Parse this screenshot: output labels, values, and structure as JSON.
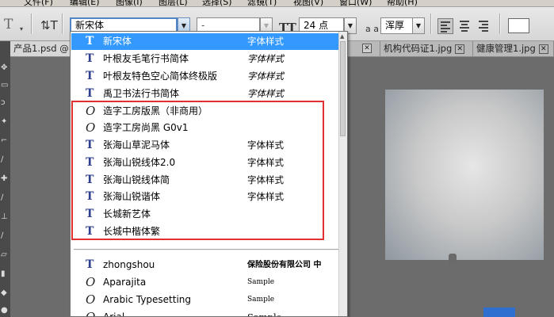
{
  "menubar": {
    "items": [
      "文件(F)",
      "编辑(E)",
      "图像(I)",
      "图层(L)",
      "选择(S)",
      "滤镜(T)",
      "视图(V)",
      "窗口(W)",
      "帮助(H)"
    ]
  },
  "options": {
    "font_family": "新宋体",
    "font_style": "-",
    "font_size": "24 点",
    "antialias": "浑厚",
    "aa_label": "a a"
  },
  "tabs": [
    {
      "label": "产品1.psd @"
    },
    {
      "label": "机构代码证1.jpg"
    },
    {
      "label": "健康管理1.jpg"
    }
  ],
  "font_list": {
    "items": [
      {
        "name": "新宋体",
        "sample": "字体样式",
        "icon": "truetype-icon",
        "selected": true
      },
      {
        "name": "叶根友毛笔行书简体",
        "sample": "字体样式",
        "icon": "truetype-icon"
      },
      {
        "name": "叶根友特色空心简体终极版",
        "sample": "字体样式",
        "icon": "truetype-icon"
      },
      {
        "name": "禹卫书法行书简体",
        "sample": "字体样式",
        "icon": "truetype-icon"
      },
      {
        "name": "造字工房版黑（非商用）",
        "sample": "",
        "icon": "opentype-icon"
      },
      {
        "name": "造字工房尚黑 G0v1",
        "sample": "",
        "icon": "opentype-icon"
      },
      {
        "name": "张海山草泥马体",
        "sample": "字体样式",
        "icon": "truetype-icon"
      },
      {
        "name": "张海山锐线体2.0",
        "sample": "字体样式",
        "icon": "truetype-icon"
      },
      {
        "name": "张海山锐线体简",
        "sample": "字体样式",
        "icon": "truetype-icon"
      },
      {
        "name": "张海山锐谐体",
        "sample": "字体样式",
        "icon": "truetype-icon"
      },
      {
        "name": "长城新艺体",
        "sample": "",
        "icon": "truetype-icon"
      },
      {
        "name": "长城中楷体繁",
        "sample": "",
        "icon": "truetype-icon"
      },
      {
        "name": "zhongshou",
        "sample": "保险股份有限公司 中",
        "icon": "truetype-icon"
      },
      {
        "name": "Aparajita",
        "sample": "Sample",
        "icon": "opentype-icon"
      },
      {
        "name": "Arabic Typesetting",
        "sample": "Sample",
        "icon": "opentype-icon"
      },
      {
        "name": "Arial",
        "sample": "Sample",
        "icon": "opentype-icon"
      }
    ]
  },
  "colors": {
    "selection": "#3399ff",
    "highlight_box": "#e03030",
    "truetype_glyph": "#2f3f8f"
  }
}
